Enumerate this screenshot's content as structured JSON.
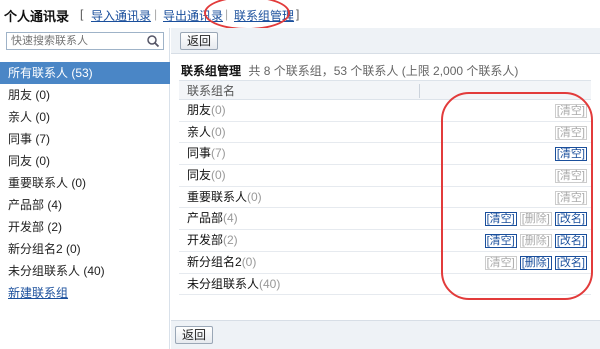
{
  "header": {
    "title": "个人通讯录",
    "bracket_open": "[",
    "import_link": "导入通讯录",
    "export_link": "导出通讯录",
    "manage_link": "联系组管理",
    "bracket_close": "]",
    "separator": "|"
  },
  "sidebar": {
    "search_placeholder": "快速搜索联系人",
    "items": [
      {
        "label": "所有联系人 (53)"
      },
      {
        "label": "朋友 (0)"
      },
      {
        "label": "亲人 (0)"
      },
      {
        "label": "同事 (7)"
      },
      {
        "label": "同友 (0)"
      },
      {
        "label": "重要联系人 (0)"
      },
      {
        "label": "产品部 (4)"
      },
      {
        "label": "开发部 (2)"
      },
      {
        "label": "新分组名2 (0)"
      },
      {
        "label": "未分组联系人 (40)"
      }
    ],
    "new_contact": "新建联系组"
  },
  "toolbar": {
    "back_label": "返回"
  },
  "main": {
    "heading_title": "联系组管理",
    "heading_sub": "共 8 个联系组，53 个联系人 (上限 2,000 个联系人)",
    "column_header": "联系组名",
    "rows": [
      {
        "name": "朋友",
        "count": "(0)",
        "clear": "[清空]",
        "delete": "",
        "rename": ""
      },
      {
        "name": "亲人",
        "count": "(0)",
        "clear": "[清空]",
        "delete": "",
        "rename": ""
      },
      {
        "name": "同事",
        "count": "(7)",
        "clear": "[清空]",
        "delete": "",
        "rename": ""
      },
      {
        "name": "同友",
        "count": "(0)",
        "clear": "[清空]",
        "delete": "",
        "rename": ""
      },
      {
        "name": "重要联系人",
        "count": "(0)",
        "clear": "[清空]",
        "delete": "",
        "rename": ""
      },
      {
        "name": "产品部",
        "count": "(4)",
        "clear": "[清空]",
        "delete": "[删除]",
        "rename": "[改名]"
      },
      {
        "name": "开发部",
        "count": "(2)",
        "clear": "[清空]",
        "delete": "[删除]",
        "rename": "[改名]"
      },
      {
        "name": "新分组名2",
        "count": "(0)",
        "clear": "[清空]",
        "delete": "[删除]",
        "rename": "[改名]"
      },
      {
        "name": "未分组联系人",
        "count": "(40)",
        "clear": "",
        "delete": "",
        "rename": ""
      }
    ]
  },
  "bottom": {
    "back_label": "返回"
  },
  "colors": {
    "accent": "#4a86c6",
    "link": "#1a4f9c",
    "annotation": "#e23b3b"
  }
}
